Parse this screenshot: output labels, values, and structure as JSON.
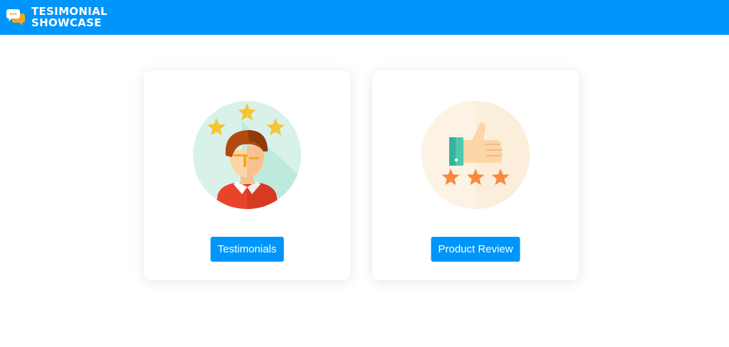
{
  "header": {
    "brand_line1": "TESIMONIAL",
    "brand_line2": "SHOWCASE",
    "logo_icon": "chat-bubbles-icon",
    "background_color": "#0095fb"
  },
  "cards": [
    {
      "illustration": "person-with-stars-icon",
      "button_label": "Testimonials"
    },
    {
      "illustration": "thumbs-up-with-stars-icon",
      "button_label": "Product Review"
    }
  ],
  "colors": {
    "accent": "#0095fb",
    "star_yellow": "#f7c531",
    "star_orange": "#f7893b"
  }
}
